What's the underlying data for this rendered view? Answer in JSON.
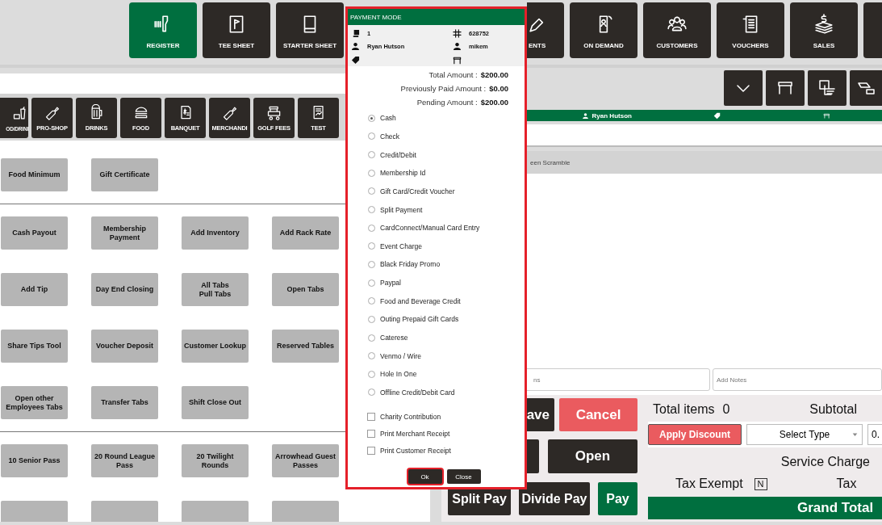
{
  "nav_tiles": [
    {
      "label": "REGISTER",
      "selected": true
    },
    {
      "label": "TEE SHEET",
      "selected": false
    },
    {
      "label": "STARTER SHEET",
      "selected": false
    },
    {
      "label": "ENTS",
      "selected": false
    },
    {
      "label": "ON DEMAND",
      "selected": false
    },
    {
      "label": "CUSTOMERS",
      "selected": false
    },
    {
      "label": "VOUCHERS",
      "selected": false
    },
    {
      "label": "SALES",
      "selected": false
    }
  ],
  "categories": [
    "OD/DRINI",
    "PRO-SHOP",
    "DRINKS",
    "FOOD",
    "BANQUET",
    "MERCHANDI",
    "GOLF FEES",
    "TEST"
  ],
  "function_sections": [
    [
      "Food Minimum",
      "Gift Certificate"
    ],
    [
      "Cash Payout",
      "Membership Payment",
      "Add Inventory",
      "Add Rack Rate",
      "Add Tip",
      "Day End Closing",
      "All Tabs\nPull Tabs",
      "Open Tabs",
      "Share Tips Tool",
      "Voucher Deposit",
      "Customer Lookup",
      "Reserved Tables",
      "Open other Employees Tabs",
      "Transfer Tabs",
      "Shift Close Out"
    ],
    [
      "10 Senior Pass",
      "20 Round League Pass",
      "20 Twilight Rounds",
      "Arrowhead Guest Passes"
    ]
  ],
  "order_panel": {
    "customer": "Ryan Hutson",
    "item_row": "een Scramble",
    "fields": [
      {
        "placeholder": "ns"
      },
      {
        "placeholder": "Add Notes"
      }
    ]
  },
  "actions": [
    [
      {
        "label": "ave",
        "kind": "dark"
      },
      {
        "label": "Cancel",
        "kind": "danger"
      }
    ],
    [
      {
        "kind": "dark"
      },
      {
        "label": "Open",
        "kind": "dark"
      }
    ],
    [
      {
        "label": "Split Pay",
        "kind": "dark"
      },
      {
        "label": "Divide Pay",
        "kind": "dark"
      },
      {
        "label": "Pay",
        "kind": "green"
      }
    ]
  ],
  "totals": {
    "total_items_label": "Total items",
    "total_items": "0",
    "subtotal_label": "Subtotal",
    "discount_button": "Apply Discount",
    "discount_type": "Select Type",
    "discount_value": "0.",
    "service_charge_label": "Service Charge",
    "tax_exempt_label": "Tax Exempt",
    "tax_exempt_value": "N",
    "tax_label": "Tax",
    "grand_total_label": "Grand Total"
  },
  "modal": {
    "title": "PAYMENT MODE",
    "tab_count": "1",
    "ticket_number": "628752",
    "customer": "Ryan Hutson",
    "server": "mikem",
    "amounts": [
      {
        "label": "Total Amount :",
        "value": "$200.00"
      },
      {
        "label": "Previously Paid Amount :",
        "value": "$0.00"
      },
      {
        "label": "Pending Amount :",
        "value": "$200.00"
      }
    ],
    "payment_methods": [
      {
        "label": "Cash",
        "selected": true
      },
      {
        "label": "Check",
        "selected": false
      },
      {
        "label": "Credit/Debit",
        "selected": false
      },
      {
        "label": "Membership Id",
        "selected": false
      },
      {
        "label": "Gift Card/Credit Voucher",
        "selected": false
      },
      {
        "label": "Split Payment",
        "selected": false
      },
      {
        "label": "CardConnect/Manual Card Entry",
        "selected": false
      },
      {
        "label": "Event Charge",
        "selected": false
      },
      {
        "label": "Black Friday Promo",
        "selected": false
      },
      {
        "label": "Paypal",
        "selected": false
      },
      {
        "label": "Food and Beverage Credit",
        "selected": false
      },
      {
        "label": "Outing Prepaid Gift Cards",
        "selected": false
      },
      {
        "label": "Caterese",
        "selected": false
      },
      {
        "label": "Venmo / Wire",
        "selected": false
      },
      {
        "label": "Hole In One",
        "selected": false
      },
      {
        "label": "Offline Credit/Debit Card",
        "selected": false
      }
    ],
    "options": [
      {
        "label": "Charity Contribution",
        "checked": false
      },
      {
        "label": "Print Merchant Receipt",
        "checked": false
      },
      {
        "label": "Print Customer Receipt",
        "checked": false
      }
    ],
    "buttons": [
      {
        "label": "Ok",
        "focused": true
      },
      {
        "label": "Close",
        "focused": false
      }
    ]
  }
}
